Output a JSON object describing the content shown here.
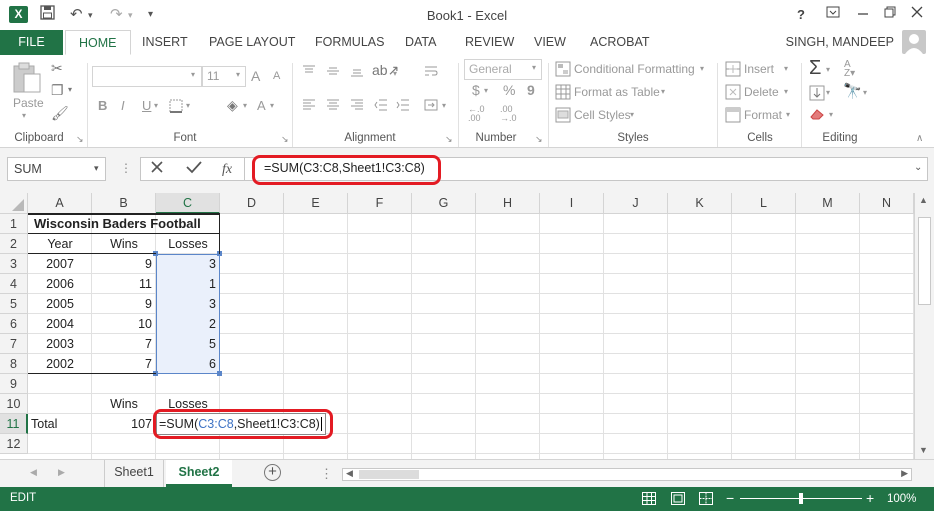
{
  "window": {
    "title": "Book1 - Excel",
    "help": "?"
  },
  "ribbon_tabs": [
    "FILE",
    "HOME",
    "INSERT",
    "PAGE LAYOUT",
    "FORMULAS",
    "DATA",
    "REVIEW",
    "VIEW",
    "ACROBAT"
  ],
  "user": "SINGH, MANDEEP",
  "clipboard": {
    "paste": "Paste",
    "label": "Clipboard"
  },
  "font": {
    "name": "",
    "size": "11",
    "bold": "B",
    "italic": "I",
    "underline": "U",
    "grow": "A",
    "shrink": "A",
    "color": "A",
    "label": "Font"
  },
  "alignment": {
    "label": "Alignment"
  },
  "number": {
    "format": "General",
    "currency": "$",
    "percent": "%",
    "comma": "9",
    "label": "Number"
  },
  "styles": {
    "conditional": "Conditional Formatting",
    "table": "Format as Table",
    "cell": "Cell Styles",
    "label": "Styles"
  },
  "cells": {
    "insert": "Insert",
    "delete": "Delete",
    "format": "Format",
    "label": "Cells"
  },
  "editing": {
    "label": "Editing"
  },
  "formula_bar": {
    "name_box": "SUM",
    "fx": "fx",
    "formula": "=SUM(C3:C8,Sheet1!C3:C8)"
  },
  "columns": [
    "A",
    "B",
    "C",
    "D",
    "E",
    "F",
    "G",
    "H",
    "I",
    "J",
    "K",
    "L",
    "M",
    "N"
  ],
  "rows": [
    "1",
    "2",
    "3",
    "4",
    "5",
    "6",
    "7",
    "8",
    "9",
    "10",
    "11",
    "12"
  ],
  "sheet": {
    "title": "Wisconsin Baders Football",
    "headers": [
      "Year",
      "Wins",
      "Losses"
    ],
    "data": [
      [
        "2007",
        "9",
        "3"
      ],
      [
        "2006",
        "11",
        "1"
      ],
      [
        "2005",
        "9",
        "3"
      ],
      [
        "2004",
        "10",
        "2"
      ],
      [
        "2003",
        "7",
        "5"
      ],
      [
        "2002",
        "7",
        "6"
      ]
    ],
    "row10": {
      "b": "Wins",
      "c": "Losses"
    },
    "row11": {
      "a": "Total",
      "b": "107",
      "c_prefix": "=SUM(",
      "c_ref": "C3:C8",
      "c_suffix": ",Sheet1!C3:C8)"
    }
  },
  "sheet_tabs": [
    "Sheet1",
    "Sheet2"
  ],
  "status": {
    "mode": "EDIT",
    "zoom": "100%",
    "zoom_minus": "−",
    "zoom_plus": "+"
  }
}
